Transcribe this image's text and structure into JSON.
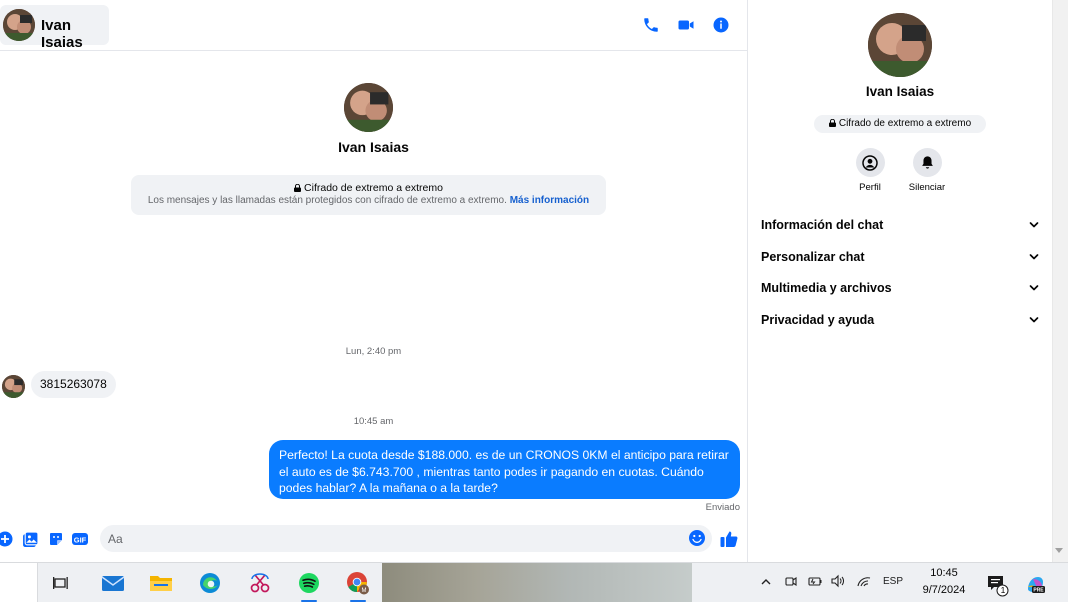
{
  "header": {
    "user_name": "Ivan Isaias",
    "icons": [
      "phone-icon",
      "video-icon",
      "info-icon"
    ]
  },
  "intro": {
    "name": "Ivan Isaias",
    "e2e_title": "Cifrado de extremo a extremo",
    "e2e_desc": "Los mensajes y las llamadas están protegidos con cifrado de extremo a extremo.",
    "e2e_link": "Más información"
  },
  "messages": [
    {
      "type": "timestamp",
      "text": "Lun, 2:40 pm"
    },
    {
      "type": "incoming",
      "text": "3815263078"
    },
    {
      "type": "timestamp",
      "text": "10:45 am"
    },
    {
      "type": "outgoing",
      "text": "Perfecto! La cuota desde $188.000. es de un CRONOS 0KM el anticipo para retirar el auto es de $6.743.700 , mientras tanto podes ir pagando en cuotas. Cuándo podes hablar? A la mañana o a la tarde?"
    }
  ],
  "message_status": "Enviado",
  "composer": {
    "placeholder": "Aa"
  },
  "right_panel": {
    "name": "Ivan Isaias",
    "e2e_label": "Cifrado de extremo a extremo",
    "actions": [
      {
        "label": "Perfil",
        "icon": "profile-icon"
      },
      {
        "label": "Silenciar",
        "icon": "bell-icon"
      }
    ],
    "sections": [
      "Información del chat",
      "Personalizar chat",
      "Multimedia y archivos",
      "Privacidad y ayuda"
    ]
  },
  "taskbar": {
    "apps": [
      "task-view-icon",
      "mail-icon",
      "file-explorer-icon",
      "edge-icon",
      "snipping-tool-icon",
      "spotify-icon",
      "chrome-icon"
    ],
    "language": "ESP",
    "time": "10:45",
    "date": "9/7/2024",
    "notification_count": "1"
  },
  "colors": {
    "accent": "#0a7cff",
    "icon_blue": "#0866ff",
    "bubble_gray": "#f0f2f5"
  }
}
